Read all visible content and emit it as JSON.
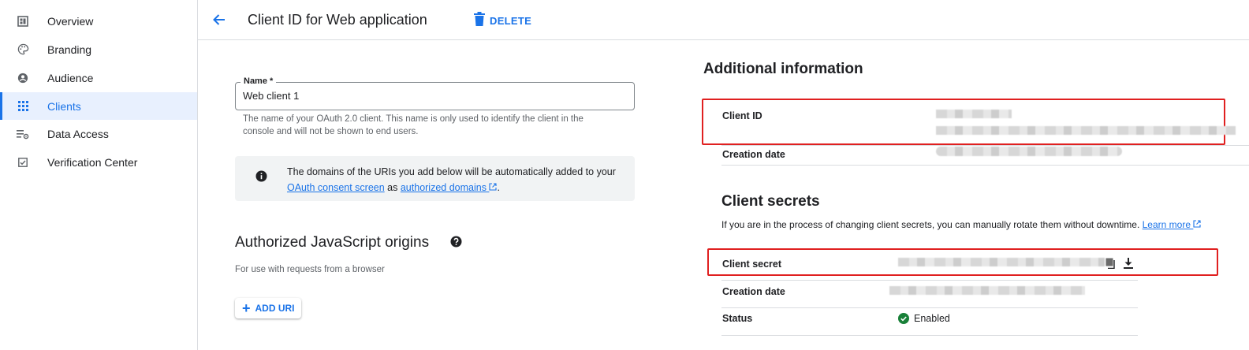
{
  "sidebar": {
    "items": [
      {
        "label": "Overview",
        "icon": "dashboard-icon"
      },
      {
        "label": "Branding",
        "icon": "palette-icon"
      },
      {
        "label": "Audience",
        "icon": "account-circle-icon"
      },
      {
        "label": "Clients",
        "icon": "grid-icon",
        "active": true
      },
      {
        "label": "Data Access",
        "icon": "data-access-icon"
      },
      {
        "label": "Verification Center",
        "icon": "verified-checkbox-icon"
      }
    ]
  },
  "header": {
    "title": "Client ID for Web application",
    "delete_label": "DELETE"
  },
  "form": {
    "name_label": "Name *",
    "name_value": "Web client 1",
    "name_hint": "The name of your OAuth 2.0 client. This name is only used to identify the client in the console and will not be shown to end users.",
    "info_text_1": "The domains of the URIs you add below will be automatically added to your",
    "info_link_1": "OAuth consent screen",
    "info_text_2": "as",
    "info_link_2": "authorized domains",
    "info_text_3": "."
  },
  "origins": {
    "title": "Authorized JavaScript origins",
    "subtitle": "For use with requests from a browser",
    "add_label": "ADD URI"
  },
  "additional": {
    "title": "Additional information",
    "client_id_label": "Client ID",
    "creation_date_label": "Creation date"
  },
  "secrets": {
    "title": "Client secrets",
    "description": "If you are in the process of changing client secrets, you can manually rotate them without downtime.",
    "learn_more": "Learn more",
    "client_secret_label": "Client secret",
    "creation_date_label": "Creation date",
    "status_label": "Status",
    "status_value": "Enabled"
  },
  "colors": {
    "accent": "#1a73e8",
    "highlight_box": "#e02020",
    "enabled_green": "#188038"
  }
}
